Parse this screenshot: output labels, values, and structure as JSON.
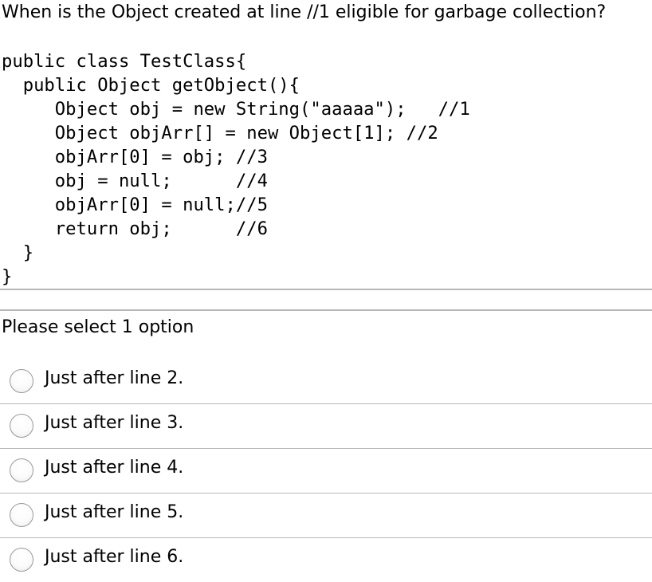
{
  "question": {
    "text": "When is the Object created at line //1 eligible for garbage collection?"
  },
  "code": {
    "lines": [
      "public class TestClass{",
      "  public Object getObject(){",
      "     Object obj = new String(\"aaaaa\");   //1",
      "     Object objArr[] = new Object[1]; //2",
      "     objArr[0] = obj; //3",
      "     obj = null;      //4",
      "     objArr[0] = null;//5",
      "     return obj;      //6",
      "  }",
      "}"
    ]
  },
  "prompt": {
    "text": "Please select 1 option"
  },
  "options": [
    {
      "label": "Just after line 2."
    },
    {
      "label": "Just after line 3."
    },
    {
      "label": "Just after line 4."
    },
    {
      "label": "Just after line 5."
    },
    {
      "label": "Just after line 6."
    }
  ]
}
